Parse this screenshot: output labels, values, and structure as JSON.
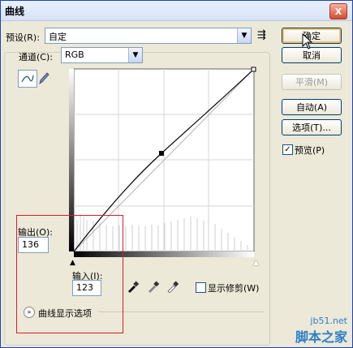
{
  "window": {
    "title": "曲线",
    "close_label": "X"
  },
  "preset": {
    "label": "预设(R):",
    "value": "自定"
  },
  "channel": {
    "label": "通道(C):",
    "value": "RGB"
  },
  "buttons": {
    "ok": "确定",
    "cancel": "取消",
    "smooth": "平滑(M)",
    "auto": "自动(A)",
    "options": "选项(T)..."
  },
  "preview": {
    "label": "预览(P)",
    "checked": true
  },
  "output": {
    "label": "输出(O):",
    "value": "136"
  },
  "input": {
    "label": "输入(I):",
    "value": "123"
  },
  "clipping": {
    "label": "显示修剪(W)",
    "checked": false
  },
  "curve_options": {
    "label": "曲线显示选项"
  },
  "icons": {
    "preset_menu": "list-menu-icon",
    "curve_tool": "curve-point-tool-icon",
    "pencil_tool": "pencil-tool-icon",
    "eyedroppers": [
      "black-eyedropper-icon",
      "gray-eyedropper-icon",
      "white-eyedropper-icon"
    ],
    "expand": "double-chevron-down-icon"
  },
  "watermark": {
    "site": "jb51.net",
    "name": "脚本之家"
  },
  "colors": {
    "accent": "#1b45b6",
    "highlight_box": "#d51f2d"
  }
}
